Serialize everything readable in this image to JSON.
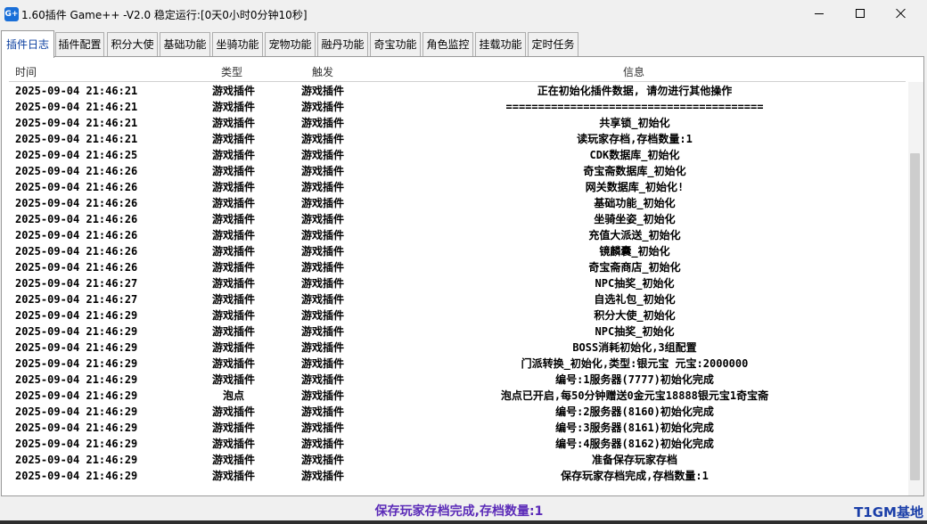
{
  "window": {
    "icon_text": "G+",
    "title": "1.60插件 Game++ -V2.0 稳定运行:[0天0小时0分钟10秒]"
  },
  "tabs": [
    {
      "label": "插件日志",
      "active": true
    },
    {
      "label": "插件配置"
    },
    {
      "label": "积分大使"
    },
    {
      "label": "基础功能"
    },
    {
      "label": "坐骑功能"
    },
    {
      "label": "宠物功能"
    },
    {
      "label": "融丹功能"
    },
    {
      "label": "奇宝功能"
    },
    {
      "label": "角色监控"
    },
    {
      "label": "挂载功能"
    },
    {
      "label": "定时任务"
    }
  ],
  "log_table": {
    "columns": {
      "time": "时间",
      "type": "类型",
      "trigger": "触发",
      "info": "信息"
    },
    "rows": [
      {
        "time": "2025-09-04 21:46:21",
        "type": "游戏插件",
        "trigger": "游戏插件",
        "info": "正在初始化插件数据, 请勿进行其他操作"
      },
      {
        "time": "2025-09-04 21:46:21",
        "type": "游戏插件",
        "trigger": "游戏插件",
        "info": "========================================"
      },
      {
        "time": "2025-09-04 21:46:21",
        "type": "游戏插件",
        "trigger": "游戏插件",
        "info": "共享锁_初始化"
      },
      {
        "time": "2025-09-04 21:46:21",
        "type": "游戏插件",
        "trigger": "游戏插件",
        "info": "读玩家存档,存档数量:1"
      },
      {
        "time": "2025-09-04 21:46:25",
        "type": "游戏插件",
        "trigger": "游戏插件",
        "info": "CDK数据库_初始化"
      },
      {
        "time": "2025-09-04 21:46:26",
        "type": "游戏插件",
        "trigger": "游戏插件",
        "info": "奇宝斋数据库_初始化"
      },
      {
        "time": "2025-09-04 21:46:26",
        "type": "游戏插件",
        "trigger": "游戏插件",
        "info": "网关数据库_初始化!"
      },
      {
        "time": "2025-09-04 21:46:26",
        "type": "游戏插件",
        "trigger": "游戏插件",
        "info": "基础功能_初始化"
      },
      {
        "time": "2025-09-04 21:46:26",
        "type": "游戏插件",
        "trigger": "游戏插件",
        "info": "坐骑坐姿_初始化"
      },
      {
        "time": "2025-09-04 21:46:26",
        "type": "游戏插件",
        "trigger": "游戏插件",
        "info": "充值大派送_初始化"
      },
      {
        "time": "2025-09-04 21:46:26",
        "type": "游戏插件",
        "trigger": "游戏插件",
        "info": "镜麟囊_初始化"
      },
      {
        "time": "2025-09-04 21:46:26",
        "type": "游戏插件",
        "trigger": "游戏插件",
        "info": "奇宝斋商店_初始化"
      },
      {
        "time": "2025-09-04 21:46:27",
        "type": "游戏插件",
        "trigger": "游戏插件",
        "info": "NPC抽奖_初始化"
      },
      {
        "time": "2025-09-04 21:46:27",
        "type": "游戏插件",
        "trigger": "游戏插件",
        "info": "自选礼包_初始化"
      },
      {
        "time": "2025-09-04 21:46:29",
        "type": "游戏插件",
        "trigger": "游戏插件",
        "info": "积分大使_初始化"
      },
      {
        "time": "2025-09-04 21:46:29",
        "type": "游戏插件",
        "trigger": "游戏插件",
        "info": "NPC抽奖_初始化"
      },
      {
        "time": "2025-09-04 21:46:29",
        "type": "游戏插件",
        "trigger": "游戏插件",
        "info": "BOSS消耗初始化,3组配置"
      },
      {
        "time": "2025-09-04 21:46:29",
        "type": "游戏插件",
        "trigger": "游戏插件",
        "info": "门派转换_初始化,类型:银元宝   元宝:2000000"
      },
      {
        "time": "2025-09-04 21:46:29",
        "type": "游戏插件",
        "trigger": "游戏插件",
        "info": "编号:1服务器(7777)初始化完成"
      },
      {
        "time": "2025-09-04 21:46:29",
        "type": "泡点",
        "trigger": "游戏插件",
        "info": "泡点已开启,每50分钟赠送0金元宝18888银元宝1奇宝斋"
      },
      {
        "time": "2025-09-04 21:46:29",
        "type": "游戏插件",
        "trigger": "游戏插件",
        "info": "编号:2服务器(8160)初始化完成"
      },
      {
        "time": "2025-09-04 21:46:29",
        "type": "游戏插件",
        "trigger": "游戏插件",
        "info": "编号:3服务器(8161)初始化完成"
      },
      {
        "time": "2025-09-04 21:46:29",
        "type": "游戏插件",
        "trigger": "游戏插件",
        "info": "编号:4服务器(8162)初始化完成"
      },
      {
        "time": "2025-09-04 21:46:29",
        "type": "游戏插件",
        "trigger": "游戏插件",
        "info": "准备保存玩家存档"
      },
      {
        "time": "2025-09-04 21:46:29",
        "type": "游戏插件",
        "trigger": "游戏插件",
        "info": "保存玩家存档完成,存档数量:1"
      }
    ]
  },
  "status_bar": {
    "message": "保存玩家存档完成,存档数量:1",
    "brand": "T1GM基地"
  },
  "colors": {
    "active_tab_text": "#0b3fa0",
    "status_message": "#5b2bb8",
    "brand": "#1a3ea8"
  }
}
